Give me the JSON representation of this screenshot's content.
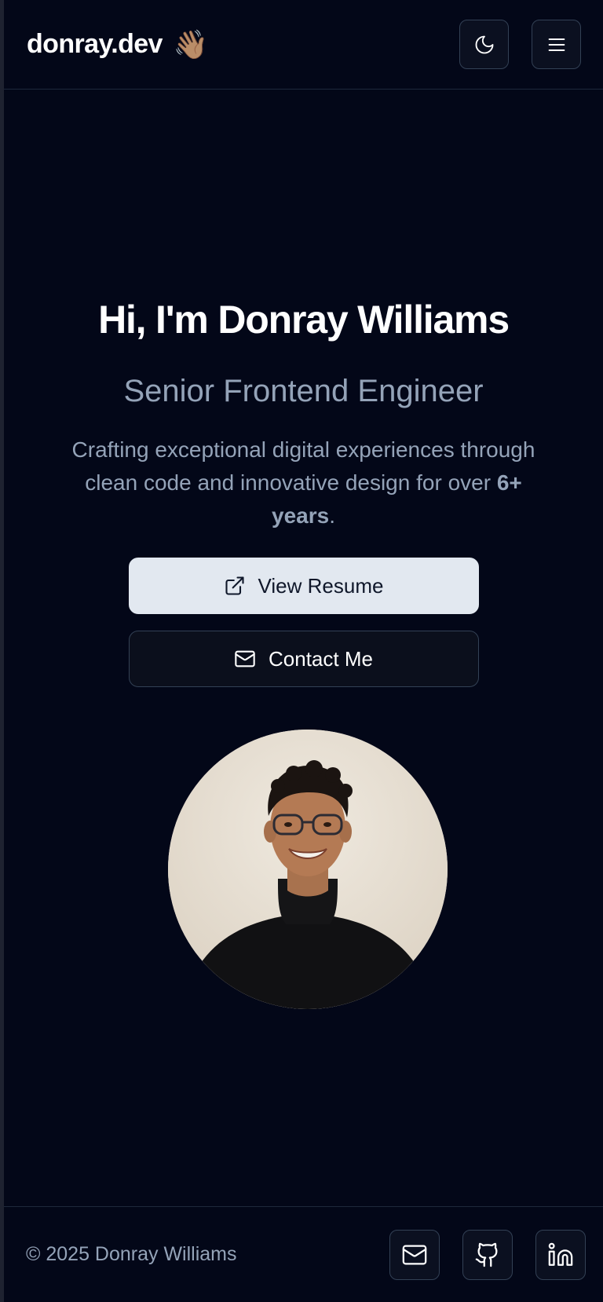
{
  "header": {
    "brand": "donray.dev",
    "wave_emoji": "👋🏽",
    "theme_toggle_icon": "moon-icon",
    "menu_icon": "hamburger-menu-icon"
  },
  "hero": {
    "title": "Hi, I'm Donray Williams",
    "subtitle": "Senior Frontend Engineer",
    "description_prefix": "Crafting exceptional digital experiences through clean code and innovative design for over ",
    "description_bold": "6+ years",
    "description_suffix": ".",
    "primary_button": {
      "label": "View Resume",
      "icon": "external-link-icon"
    },
    "secondary_button": {
      "label": "Contact Me",
      "icon": "mail-icon"
    }
  },
  "avatar": {
    "alt": "Donray Williams portrait"
  },
  "footer": {
    "copyright": "© 2025 Donray Williams",
    "social": [
      {
        "name": "email",
        "icon": "mail-icon"
      },
      {
        "name": "github",
        "icon": "github-icon"
      },
      {
        "name": "linkedin",
        "icon": "linkedin-icon"
      }
    ]
  },
  "colors": {
    "background": "#030718",
    "border": "#1e293b",
    "muted_text": "#94a3b8",
    "primary_button_bg": "#e2e8f0",
    "heading": "#ffffff"
  }
}
